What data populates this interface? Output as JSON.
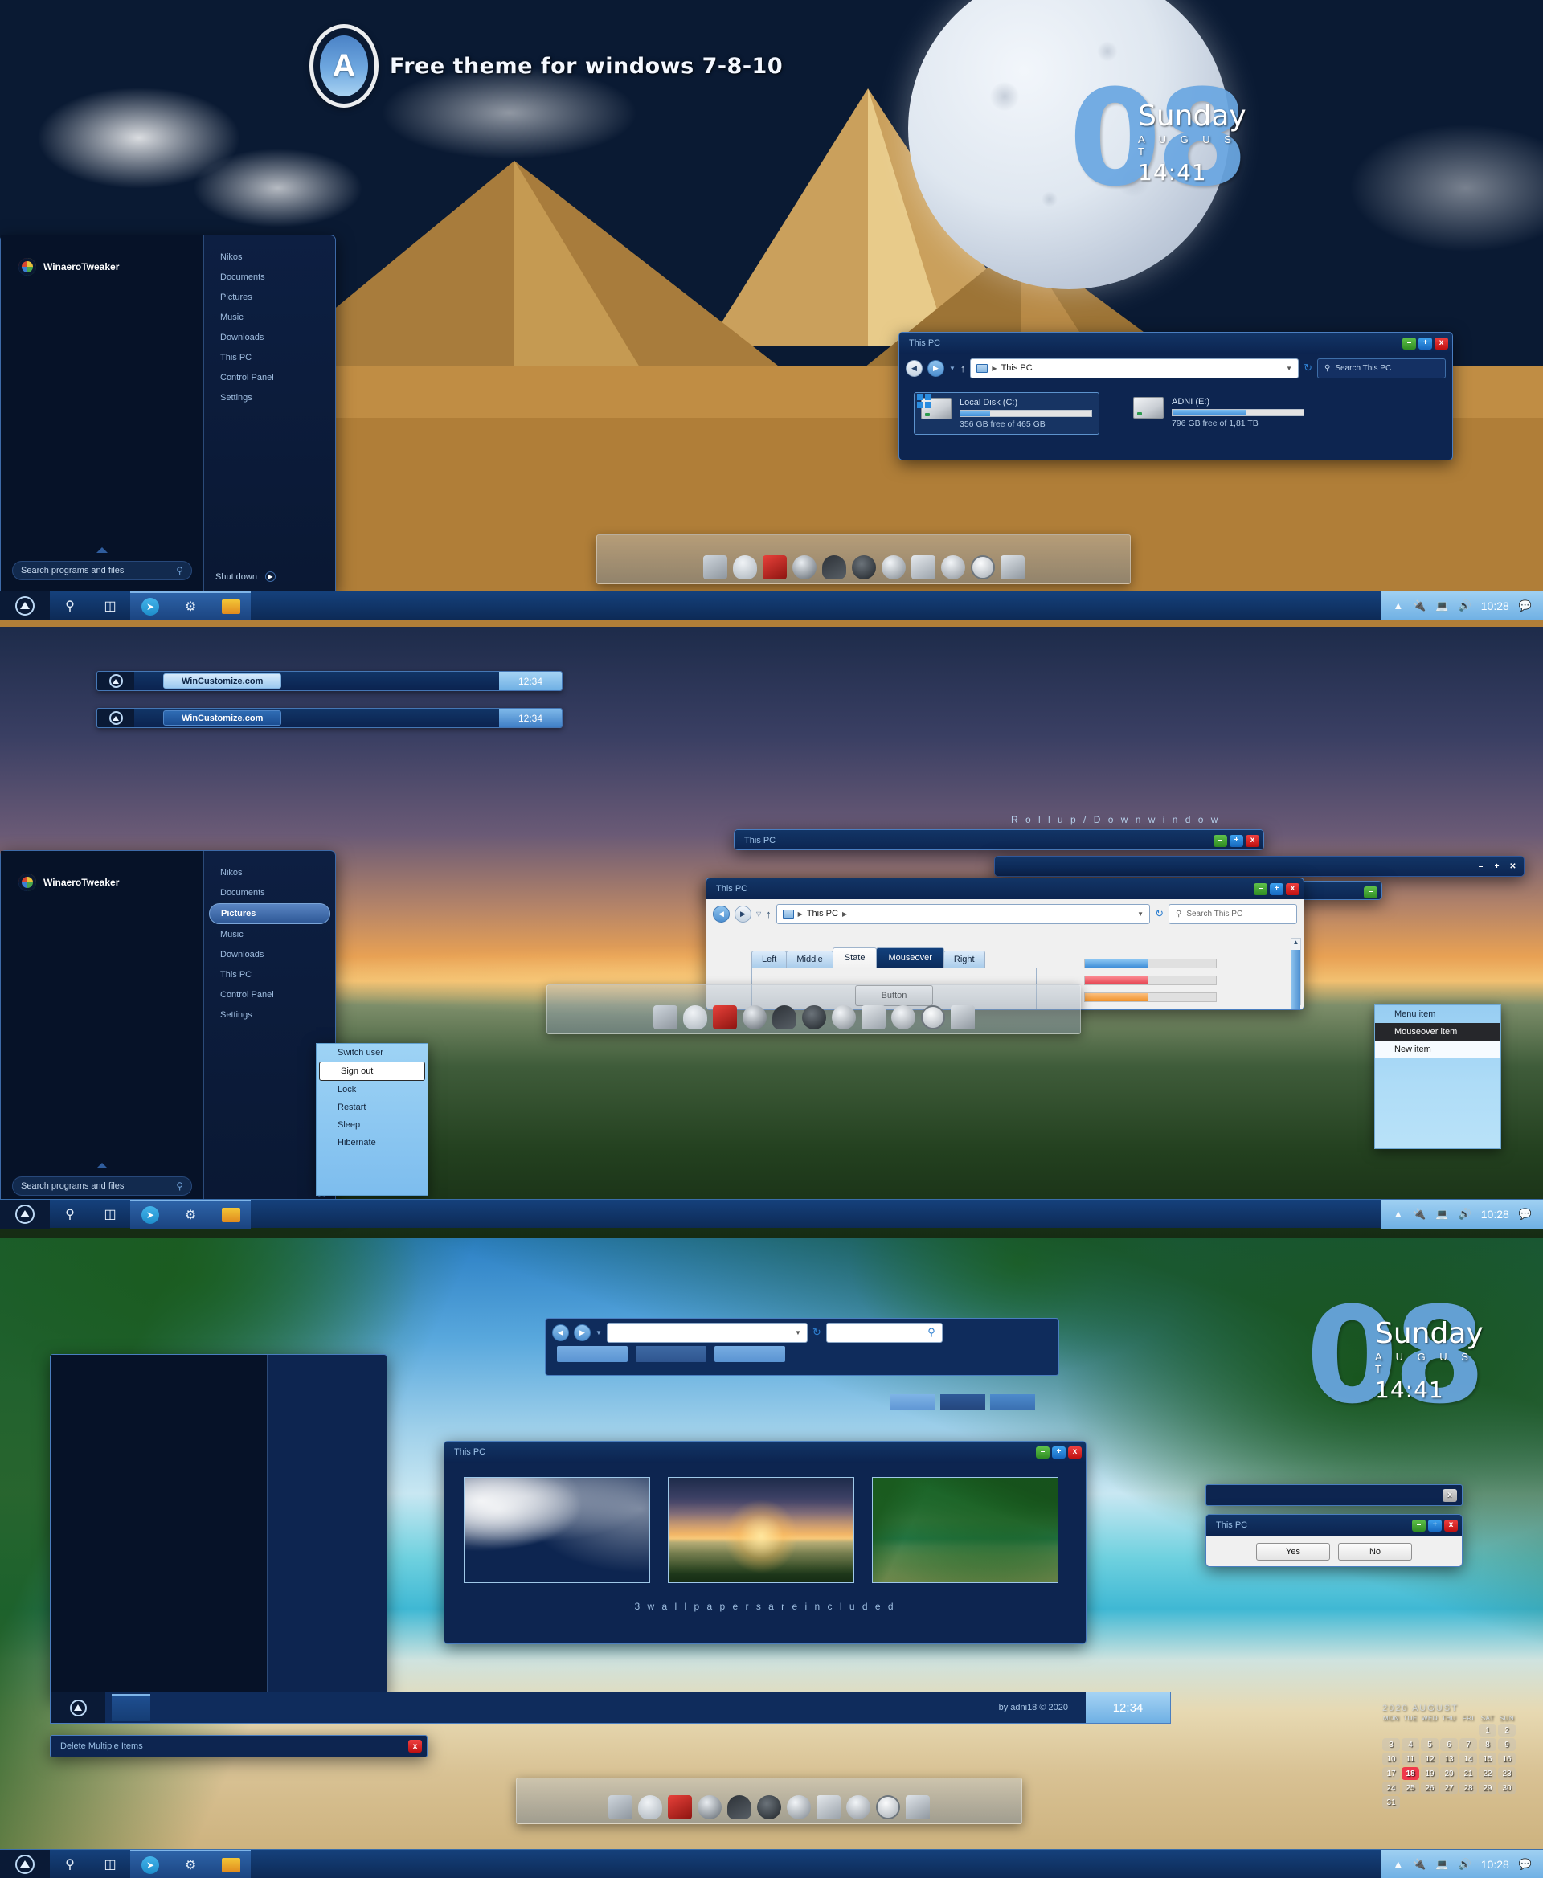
{
  "theme": {
    "name": "Free theme for windows 7-8-10",
    "logo_letter": "A",
    "credit": "by adni18 © 2020",
    "accent": "#2f6cb4",
    "titlebar_bg": "#0c2450",
    "menu_bg": "#0a1833"
  },
  "clock_widget": {
    "day_number": "08",
    "weekday": "Sunday",
    "month": "A U G U S T",
    "time": "14:41"
  },
  "start_menu": {
    "app_name": "WinaeroTweaker",
    "items": [
      "Nikos",
      "Documents",
      "Pictures",
      "Music",
      "Downloads",
      "This PC",
      "Control Panel",
      "Settings"
    ],
    "active_item": "Pictures",
    "search_placeholder": "Search programs and files",
    "shutdown_label": "Shut down",
    "search_icon": "search-icon"
  },
  "power_flyout": {
    "items": [
      "Switch user",
      "Sign out",
      "Lock",
      "Restart",
      "Sleep",
      "Hibernate"
    ],
    "selected": "Sign out"
  },
  "explorer": {
    "title": "This PC",
    "address_value": "This PC",
    "search_placeholder": "Search This PC",
    "drives": [
      {
        "name": "Local Disk (C:)",
        "free_text": "356 GB free of 465 GB",
        "used_percent": 23,
        "selected": true
      },
      {
        "name": "ADNI (E:)",
        "free_text": "796 GB free of 1,81 TB",
        "used_percent": 56,
        "selected": false
      }
    ],
    "window_buttons": {
      "minimize": "minimize-button",
      "maximize": "maximize-button",
      "close": "close-button"
    }
  },
  "taskbar": {
    "start_label": "start-orb",
    "icons": [
      "search-icon",
      "task-view-icon",
      "telegram-icon",
      "settings-gear-icon",
      "file-explorer-icon"
    ],
    "tray": {
      "chevron": "show-hidden-icon",
      "usb": "usb-icon",
      "network": "network-icon",
      "volume": "volume-icon",
      "clock": "10:28",
      "action_center": "action-center-icon"
    }
  },
  "titlebar_samples": {
    "label": "WinCustomize.com",
    "time": "12:34",
    "rows": [
      {
        "style": "active",
        "label": "WinCustomize.com",
        "time": "12:34"
      },
      {
        "style": "inactive",
        "label": "WinCustomize.com",
        "time": "12:34"
      }
    ]
  },
  "rollup_label": "R o l l u p  /  D o w n   w i n d o w",
  "controls_demo": {
    "tabs": [
      "Left",
      "Middle",
      "State",
      "Mouseover",
      "Right"
    ],
    "active_tab": "Mouseover",
    "button_label": "Button",
    "progress_bars": [
      {
        "color": "#3f8ed8",
        "value": 48
      },
      {
        "color": "#e5424f",
        "value": 48
      },
      {
        "color": "#f0922c",
        "value": 48
      }
    ]
  },
  "popup_menu": {
    "items": [
      "Menu item",
      "Mouseover item",
      "New item"
    ],
    "hover_item": "Mouseover item",
    "selected_item": "New item"
  },
  "wallpapers_window": {
    "title": "This PC",
    "caption": "3  w a l l p a p e r s  a r e  i n c l u d e d",
    "thumbnails": [
      "pyramids-moon-wallpaper",
      "sunset-fields-wallpaper",
      "tropical-beach-wallpaper"
    ]
  },
  "dialog": {
    "title": "This PC",
    "buttons": [
      "Yes",
      "No"
    ]
  },
  "delete_dialog": {
    "title": "Delete Multiple Items",
    "close_icon": "close-button"
  },
  "taskbar3": {
    "credit": "by adni18 © 2020",
    "time": "12:34"
  },
  "calendar": {
    "year": "2020",
    "month": "AUGUST",
    "weekdays": [
      "MON",
      "TUE",
      "WED",
      "THU",
      "FRI",
      "SAT",
      "SUN"
    ],
    "lead_blanks": 5,
    "days": 31,
    "today": 18
  }
}
